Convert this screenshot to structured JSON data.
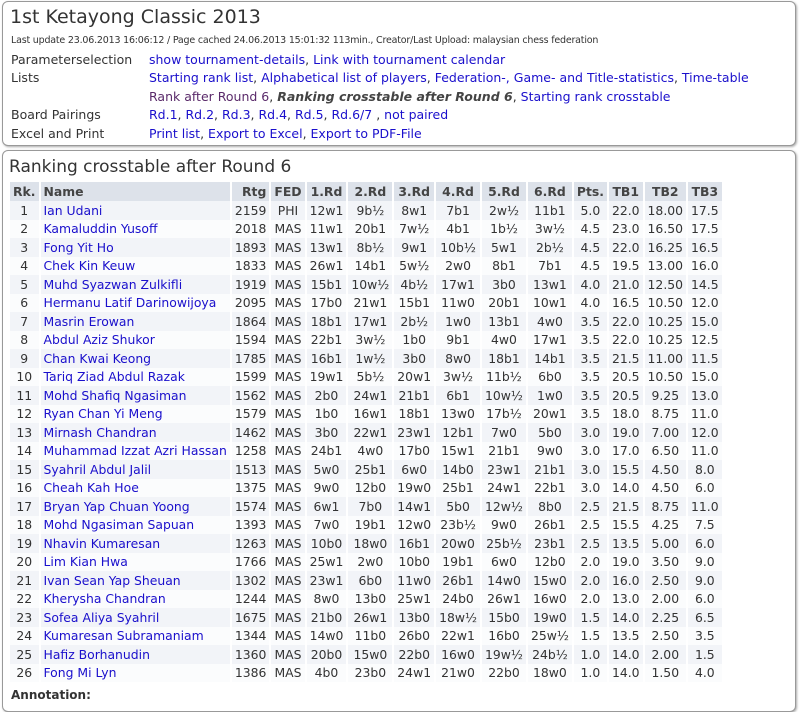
{
  "title": "1st Ketayong Classic 2013",
  "update": "Last update 23.06.2013 16:06:12 / Page cached 24.06.2013 15:01:32 113min., Creator/Last Upload: malaysian chess federation",
  "params": {
    "parameterselection": {
      "label": "Parameterselection",
      "links": [
        "show tournament-details",
        "Link with tournament calendar"
      ]
    },
    "lists": {
      "label": "Lists",
      "links": [
        "Starting rank list",
        "Alphabetical list of players",
        "Federation-, Game- and Title-statistics",
        "Time-table"
      ],
      "links2": [
        "Rank after Round 6",
        "Ranking crosstable after Round 6",
        "Starting rank crosstable"
      ]
    },
    "pairings": {
      "label": "Board Pairings",
      "links": [
        "Rd.1",
        "Rd.2",
        "Rd.3",
        "Rd.4",
        "Rd.5",
        "Rd.6/7",
        "not paired"
      ]
    },
    "excel": {
      "label": "Excel and Print",
      "links": [
        "Print list",
        "Export to Excel",
        "Export to PDF-File"
      ]
    }
  },
  "section_title": "Ranking crosstable after Round 6",
  "columns": [
    "Rk.",
    "Name",
    "Rtg",
    "FED",
    "1.Rd",
    "2.Rd",
    "3.Rd",
    "4.Rd",
    "5.Rd",
    "6.Rd",
    "Pts.",
    "TB1",
    "TB2",
    "TB3"
  ],
  "rows": [
    [
      "1",
      "Ian Udani",
      "2159",
      "PHI",
      "12w1",
      "9b½",
      "8w1",
      "7b1",
      "2w½",
      "11b1",
      "5.0",
      "22.0",
      "18.00",
      "17.5"
    ],
    [
      "2",
      "Kamaluddin Yusoff",
      "2018",
      "MAS",
      "11w1",
      "20b1",
      "7w½",
      "4b1",
      "1b½",
      "3w½",
      "4.5",
      "23.0",
      "16.50",
      "17.5"
    ],
    [
      "3",
      "Fong Yit Ho",
      "1893",
      "MAS",
      "13w1",
      "8b½",
      "9w1",
      "10b½",
      "5w1",
      "2b½",
      "4.5",
      "22.0",
      "16.25",
      "16.5"
    ],
    [
      "4",
      "Chek Kin Keuw",
      "1833",
      "MAS",
      "26w1",
      "14b1",
      "5w½",
      "2w0",
      "8b1",
      "7b1",
      "4.5",
      "19.5",
      "13.00",
      "16.0"
    ],
    [
      "5",
      "Muhd Syazwan Zulkifli",
      "1919",
      "MAS",
      "15b1",
      "10w½",
      "4b½",
      "17w1",
      "3b0",
      "13w1",
      "4.0",
      "21.0",
      "12.50",
      "14.5"
    ],
    [
      "6",
      "Hermanu Latif Darinowijoya",
      "2095",
      "MAS",
      "17b0",
      "21w1",
      "15b1",
      "11w0",
      "20b1",
      "10w1",
      "4.0",
      "16.5",
      "10.50",
      "12.0"
    ],
    [
      "7",
      "Masrin Erowan",
      "1864",
      "MAS",
      "18b1",
      "17w1",
      "2b½",
      "1w0",
      "13b1",
      "4w0",
      "3.5",
      "22.0",
      "10.25",
      "15.0"
    ],
    [
      "8",
      "Abdul Aziz Shukor",
      "1594",
      "MAS",
      "22b1",
      "3w½",
      "1b0",
      "9b1",
      "4w0",
      "17w1",
      "3.5",
      "22.0",
      "10.25",
      "12.5"
    ],
    [
      "9",
      "Chan Kwai Keong",
      "1785",
      "MAS",
      "16b1",
      "1w½",
      "3b0",
      "8w0",
      "18b1",
      "14b1",
      "3.5",
      "21.5",
      "11.00",
      "11.5"
    ],
    [
      "10",
      "Tariq Ziad Abdul Razak",
      "1599",
      "MAS",
      "19w1",
      "5b½",
      "20w1",
      "3w½",
      "11b½",
      "6b0",
      "3.5",
      "20.5",
      "10.50",
      "15.0"
    ],
    [
      "11",
      "Mohd Shafiq Ngasiman",
      "1562",
      "MAS",
      "2b0",
      "24w1",
      "21b1",
      "6b1",
      "10w½",
      "1w0",
      "3.5",
      "20.5",
      "9.25",
      "13.0"
    ],
    [
      "12",
      "Ryan Chan Yi Meng",
      "1579",
      "MAS",
      "1b0",
      "16w1",
      "18b1",
      "13w0",
      "17b½",
      "20w1",
      "3.5",
      "18.0",
      "8.75",
      "11.0"
    ],
    [
      "13",
      "Mirnash Chandran",
      "1462",
      "MAS",
      "3b0",
      "22w1",
      "23w1",
      "12b1",
      "7w0",
      "5b0",
      "3.0",
      "19.0",
      "7.00",
      "12.0"
    ],
    [
      "14",
      "Muhammad Izzat Azri Hassan",
      "1258",
      "MAS",
      "24b1",
      "4w0",
      "17b0",
      "15w1",
      "21b1",
      "9w0",
      "3.0",
      "17.0",
      "6.50",
      "11.0"
    ],
    [
      "15",
      "Syahril Abdul Jalil",
      "1513",
      "MAS",
      "5w0",
      "25b1",
      "6w0",
      "14b0",
      "23w1",
      "21b1",
      "3.0",
      "15.5",
      "4.50",
      "8.0"
    ],
    [
      "16",
      "Cheah Kah Hoe",
      "1375",
      "MAS",
      "9w0",
      "12b0",
      "19w0",
      "25b1",
      "24w1",
      "22b1",
      "3.0",
      "14.0",
      "4.50",
      "6.0"
    ],
    [
      "17",
      "Bryan Yap Chuan Yoong",
      "1574",
      "MAS",
      "6w1",
      "7b0",
      "14w1",
      "5b0",
      "12w½",
      "8b0",
      "2.5",
      "21.5",
      "8.75",
      "11.0"
    ],
    [
      "18",
      "Mohd Ngasiman Sapuan",
      "1393",
      "MAS",
      "7w0",
      "19b1",
      "12w0",
      "23b½",
      "9w0",
      "26b1",
      "2.5",
      "15.5",
      "4.25",
      "7.5"
    ],
    [
      "19",
      "Nhavin Kumaresan",
      "1263",
      "MAS",
      "10b0",
      "18w0",
      "16b1",
      "20w0",
      "25b½",
      "23b1",
      "2.5",
      "13.5",
      "5.00",
      "6.0"
    ],
    [
      "20",
      "Lim Kian Hwa",
      "1766",
      "MAS",
      "25w1",
      "2w0",
      "10b0",
      "19b1",
      "6w0",
      "12b0",
      "2.0",
      "19.0",
      "3.50",
      "9.0"
    ],
    [
      "21",
      "Ivan Sean Yap Sheuan",
      "1302",
      "MAS",
      "23w1",
      "6b0",
      "11w0",
      "26b1",
      "14w0",
      "15w0",
      "2.0",
      "16.0",
      "2.50",
      "9.0"
    ],
    [
      "22",
      "Kherysha Chandran",
      "1244",
      "MAS",
      "8w0",
      "13b0",
      "25w1",
      "24b0",
      "26w1",
      "16w0",
      "2.0",
      "13.0",
      "2.00",
      "6.0"
    ],
    [
      "23",
      "Sofea Aliya Syahril",
      "1675",
      "MAS",
      "21b0",
      "26w1",
      "13b0",
      "18w½",
      "15b0",
      "19w0",
      "1.5",
      "14.0",
      "2.25",
      "6.5"
    ],
    [
      "24",
      "Kumaresan Subramaniam",
      "1344",
      "MAS",
      "14w0",
      "11b0",
      "26b0",
      "22w1",
      "16b0",
      "25w½",
      "1.5",
      "13.5",
      "2.50",
      "3.5"
    ],
    [
      "25",
      "Hafiz Borhanudin",
      "1360",
      "MAS",
      "20b0",
      "15w0",
      "22b0",
      "16w0",
      "19w½",
      "24b½",
      "1.0",
      "14.0",
      "2.00",
      "1.5"
    ],
    [
      "26",
      "Fong Mi Lyn",
      "1386",
      "MAS",
      "4b0",
      "23b0",
      "24w1",
      "21w0",
      "22b0",
      "18w0",
      "1.0",
      "14.0",
      "1.50",
      "4.0"
    ]
  ],
  "annotation": "Annotation:"
}
